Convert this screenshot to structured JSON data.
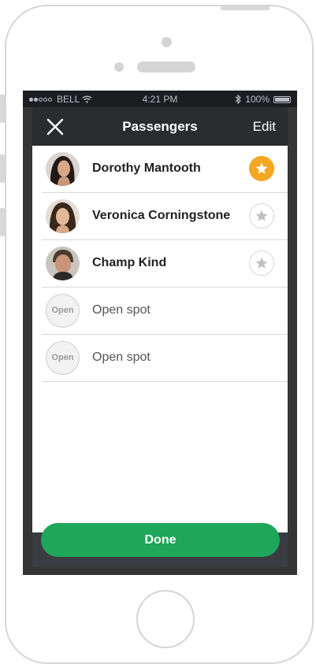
{
  "status_bar": {
    "carrier": "BELL",
    "time": "4:21 PM",
    "battery": "100%"
  },
  "header": {
    "title": "Passengers",
    "edit_label": "Edit",
    "close_icon": "close-icon"
  },
  "passengers": [
    {
      "name": "Dorothy Mantooth",
      "starred": true
    },
    {
      "name": "Veronica Corningstone",
      "starred": false
    },
    {
      "name": "Champ Kind",
      "starred": false
    }
  ],
  "open_spots": [
    {
      "badge": "Open",
      "label": "Open spot"
    },
    {
      "badge": "Open",
      "label": "Open spot"
    }
  ],
  "footer": {
    "done_label": "Done"
  },
  "colors": {
    "accent_green": "#1ea65a",
    "star_active": "#f5a623",
    "header_bg": "#2b2c30"
  }
}
